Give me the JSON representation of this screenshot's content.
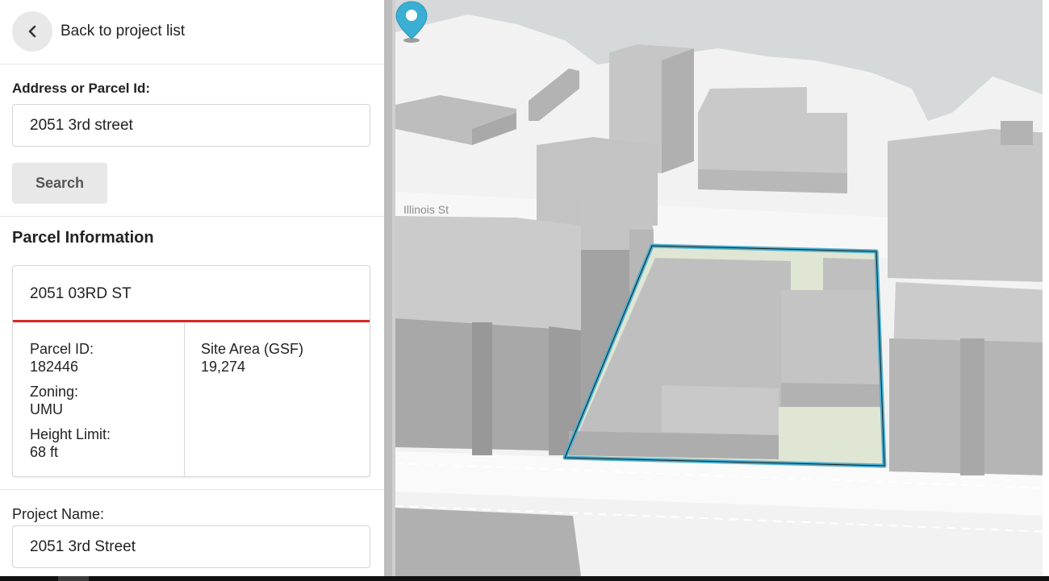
{
  "nav": {
    "back_label": "Back to project list",
    "back_icon": "chevron-left-icon"
  },
  "search": {
    "address_label": "Address or Parcel Id:",
    "address_value": "2051 3rd street",
    "button_label": "Search"
  },
  "parcel": {
    "heading": "Parcel Information",
    "address": "2051 03RD ST",
    "accent_color": "#d62828",
    "fields_left": [
      {
        "label": "Parcel ID:",
        "value": "182446"
      },
      {
        "label": "Zoning:",
        "value": "UMU"
      },
      {
        "label": "Height Limit:",
        "value": "68 ft"
      }
    ],
    "fields_right": [
      {
        "label": "Site Area (GSF)",
        "value": "19,274"
      }
    ]
  },
  "project": {
    "name_label": "Project Name:",
    "name_value": "2051 3rd Street"
  },
  "map": {
    "street_label": "Illinois St",
    "parcel_outline_color": "#4bb0d0",
    "pin_color": "#3aaed3",
    "pin_icon": "map-pin-icon"
  }
}
